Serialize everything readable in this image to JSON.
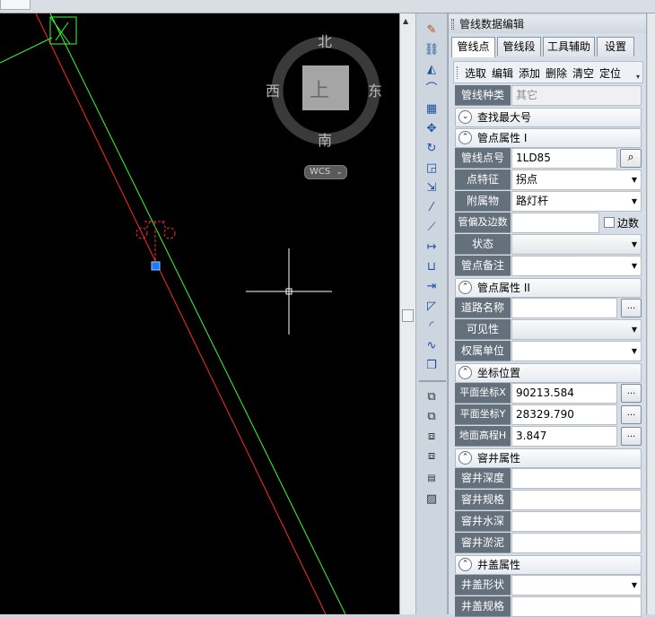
{
  "compass": {
    "north": "北",
    "south": "南",
    "west": "西",
    "east": "东",
    "center": "上"
  },
  "wcs": {
    "label": "WCS",
    "chevron": "⌄"
  },
  "panel": {
    "title": "管线数据编辑",
    "tabs": [
      "管线点",
      "管线段",
      "工具辅助",
      "设置"
    ],
    "actions": [
      "选取",
      "编辑",
      "添加",
      "删除",
      "清空",
      "定位"
    ],
    "pipe_type": {
      "label": "管线种类",
      "value": "其它"
    },
    "find_max": "查找最大号",
    "section1": "管点属性 I",
    "pipe_point_no": {
      "label": "管线点号",
      "value": "1LD85"
    },
    "feature": {
      "label": "点特征",
      "value": "拐点"
    },
    "attachment": {
      "label": "附属物",
      "value": "路灯杆"
    },
    "offset": {
      "label": "管偏及边数",
      "value": "",
      "checkbox_label": "边数"
    },
    "status": {
      "label": "状态",
      "value": ""
    },
    "note": {
      "label": "管点备注",
      "value": ""
    },
    "section2": "管点属性 II",
    "road_name": {
      "label": "道路名称",
      "value": ""
    },
    "visibility": {
      "label": "可见性",
      "value": ""
    },
    "owner": {
      "label": "权属单位",
      "value": ""
    },
    "section3": "坐标位置",
    "coord_x": {
      "label": "平面坐标X",
      "value": "90213.584"
    },
    "coord_y": {
      "label": "平面坐标Y",
      "value": "28329.790"
    },
    "elevation": {
      "label": "地面高程H",
      "value": "3.847"
    },
    "section4": "窨井属性",
    "well_depth": {
      "label": "窨井深度",
      "value": ""
    },
    "well_spec": {
      "label": "窨井规格",
      "value": ""
    },
    "well_water": {
      "label": "窨井水深",
      "value": ""
    },
    "well_silt": {
      "label": "窨井淤泥",
      "value": ""
    },
    "section5": "井盖属性",
    "cover_shape": {
      "label": "井盖形状",
      "value": ""
    },
    "cover_spec": {
      "label": "井盖规格",
      "value": ""
    },
    "ellipsis": "...",
    "dropdown": "▼",
    "chevron_up": "⌃",
    "chevron_down": "⌄"
  },
  "colors": {
    "canvas": "#000000",
    "red_line": "#ff2a2a",
    "green_line": "#33ff33",
    "selection": "#1e78ff",
    "label_bg": "#64707c"
  },
  "toolbar_icons": [
    "brush-icon",
    "link-icon",
    "mirror-icon",
    "offset-icon",
    "array-icon",
    "move-icon",
    "rotate-icon",
    "scale-icon",
    "stretch-icon",
    "trim-icon",
    "extend-icon",
    "break-at-point-icon",
    "break-icon",
    "join-icon",
    "chamfer-icon",
    "fillet-icon",
    "spline-icon",
    "explode-icon",
    "draw-order-front-icon",
    "draw-order-back-icon",
    "bring-above-icon",
    "send-under-icon",
    "text-to-front-icon",
    "hatch-to-back-icon"
  ]
}
